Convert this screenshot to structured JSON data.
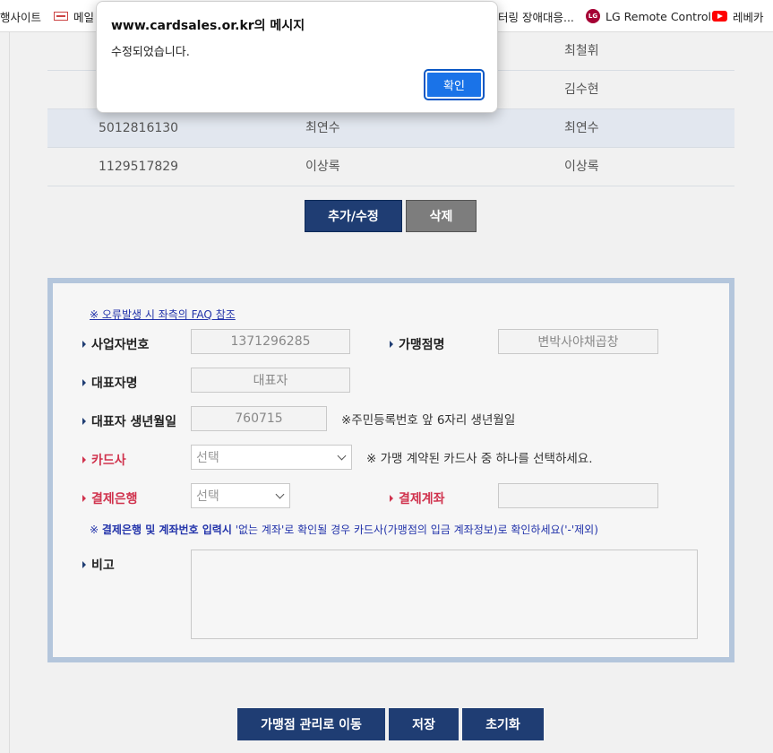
{
  "bookmarks": [
    {
      "label": "행사이트",
      "icon": "none"
    },
    {
      "label": "메일",
      "icon": "mail-icon"
    },
    {
      "label": "터링 장애대응...",
      "icon": "none"
    },
    {
      "label": "LG Remote Control",
      "icon": "lg-icon"
    },
    {
      "label": "레베카",
      "icon": "youtube-icon"
    }
  ],
  "table": {
    "rows": [
      {
        "biz_no": "",
        "name": "",
        "rep": "최철휘",
        "shaded": false
      },
      {
        "biz_no": "",
        "name": "",
        "rep": "김수현",
        "shaded": false
      },
      {
        "biz_no": "5012816130",
        "name": "최연수",
        "rep": "최연수",
        "shaded": true
      },
      {
        "biz_no": "1129517829",
        "name": "이상록",
        "rep": "이상록",
        "shaded": false
      }
    ]
  },
  "actions": {
    "add_edit": "추가/수정",
    "delete": "삭제"
  },
  "form": {
    "faq_link": "※ 오류발생 시 좌측의 FAQ 참조",
    "biz_no_label": "사업자번호",
    "biz_no_value": "1371296285",
    "merchant_label": "가맹점명",
    "merchant_value": "변박사야채곱창",
    "rep_label": "대표자명",
    "rep_value": "대표자",
    "birth_label": "대표자 생년월일",
    "birth_value": "760715",
    "birth_note": "※주민등록번호 앞 6자리 생년월일",
    "card_label": "카드사",
    "card_value": "선택",
    "card_note": "※ 가맹 계약된 카드사 중 하나를 선택하세요.",
    "bank_label": "결제은행",
    "bank_value": "선택",
    "account_label": "결제계좌",
    "account_value": "",
    "bank_note_prefix": "※ ",
    "bank_note_bold": "결제은행 및 계좌번호 입력시",
    "bank_note_rest": " '없는 계좌'로 확인될 경우 카드사(가맹점의 입금 계좌정보)로 확인하세요('-'제외)",
    "memo_label": "비고",
    "memo_value": ""
  },
  "bottom_buttons": {
    "go_merchant": "가맹점 관리로 이동",
    "save": "저장",
    "reset": "초기화"
  },
  "dialog": {
    "title": "www.cardsales.or.kr의 메시지",
    "message": "수정되었습니다.",
    "ok": "확인"
  },
  "colors": {
    "navy": "#1f3d73",
    "gray_button": "#7d7d7d",
    "required_red": "#d0324d",
    "dialog_blue": "#1a73e8"
  }
}
